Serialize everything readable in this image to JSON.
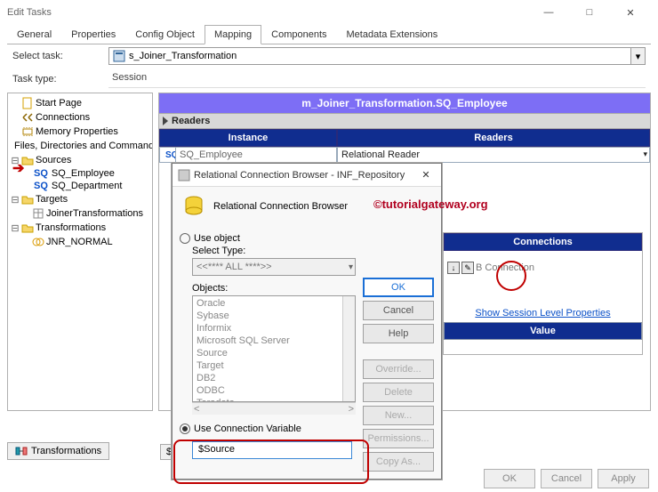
{
  "window": {
    "title": "Edit Tasks"
  },
  "tabs": [
    "General",
    "Properties",
    "Config Object",
    "Mapping",
    "Components",
    "Metadata Extensions"
  ],
  "active_tab": "Mapping",
  "select_task": {
    "label": "Select task:",
    "value": "s_Joiner_Transformation"
  },
  "task_type": {
    "label": "Task type:",
    "value": "Session"
  },
  "tree": {
    "start_page": "Start Page",
    "connections": "Connections",
    "memory_properties": "Memory Properties",
    "files_dirs": "Files, Directories and Commands",
    "sources": "Sources",
    "sq_employee": "SQ_Employee",
    "sq_department": "SQ_Department",
    "targets": "Targets",
    "joiner_trans": "JoinerTransformations",
    "transformations": "Transformations",
    "jnr_normal": "JNR_NORMAL"
  },
  "mapping": {
    "header": "m_Joiner_Transformation.SQ_Employee",
    "section_readers": "Readers",
    "col_instance": "Instance",
    "col_readers": "Readers",
    "sq_prefix": "SQ",
    "row_instance": "SQ_Employee",
    "row_reader": "Relational Reader",
    "connections_label": "Connections",
    "db_conn": "B Connection",
    "show_props": "Show Session Level Properties",
    "value_label": "Value"
  },
  "sourcesTab": "$o",
  "bottom_tab": "Transformations",
  "dialog": {
    "title": "Relational Connection Browser - INF_Repository",
    "subtitle": "Relational Connection Browser",
    "use_object": "Use object",
    "select_type": "Select Type:",
    "type_value": "<<**** ALL ****>>",
    "objects_label": "Objects:",
    "objects": [
      "Oracle",
      "Sybase",
      "Informix",
      "Microsoft SQL Server",
      "   Source",
      "   Target",
      "DB2",
      "ODBC",
      "Teradata"
    ],
    "use_conn_var": "Use Connection Variable",
    "conn_var_value": "$Source",
    "buttons": {
      "ok": "OK",
      "cancel": "Cancel",
      "help": "Help",
      "override": "Override...",
      "delete": "Delete",
      "new": "New...",
      "perm": "Permissions...",
      "copy": "Copy As..."
    }
  },
  "watermark": "©tutorialgateway.org",
  "footer": {
    "ok": "OK",
    "cancel": "Cancel",
    "apply": "Apply"
  }
}
